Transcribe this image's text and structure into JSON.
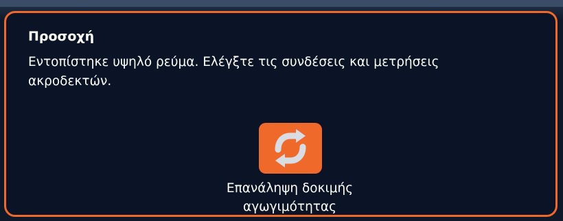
{
  "dialog": {
    "title": "Προσοχή",
    "message": "Εντοπίστηκε υψηλό ρεύμα. Ελέγξτε τις συνδέσεις και μετρήσεις ακροδεκτών.",
    "retry_button": {
      "icon": "refresh-icon",
      "label_line1": "Επανάληψη δοκιμής",
      "label_line2": "αγωγιμότητας"
    }
  },
  "colors": {
    "accent": "#ef6a2a",
    "background": "#0b1427",
    "text": "#ffffff",
    "icon": "#d9dde3"
  }
}
